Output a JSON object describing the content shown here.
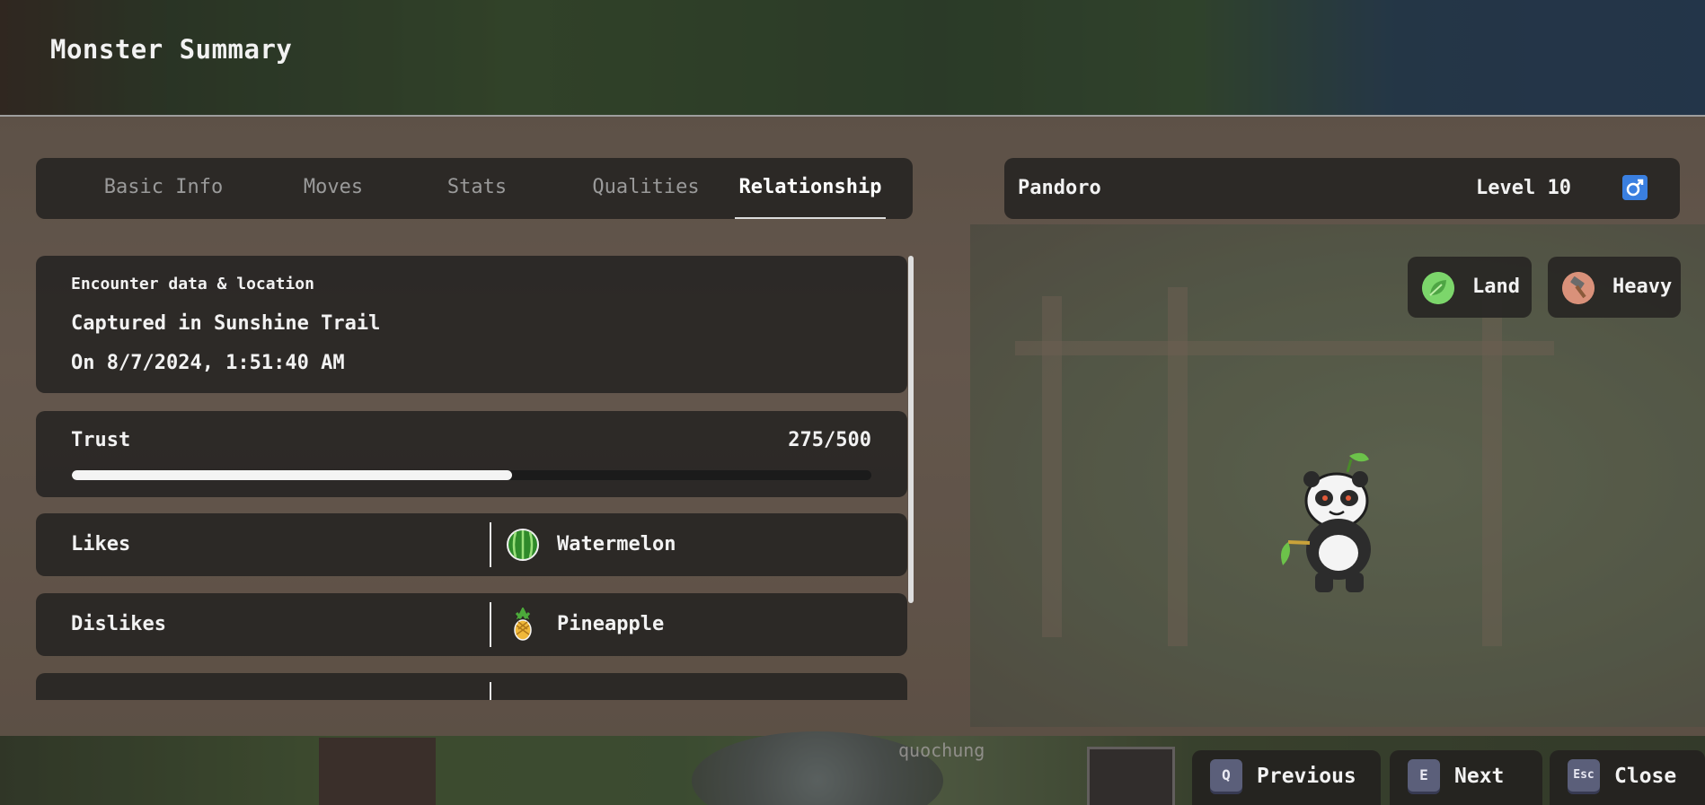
{
  "header": {
    "title": "Monster Summary"
  },
  "tabs": [
    {
      "label": "Basic Info",
      "active": false
    },
    {
      "label": "Moves",
      "active": false
    },
    {
      "label": "Stats",
      "active": false
    },
    {
      "label": "Qualities",
      "active": false
    },
    {
      "label": "Relationship",
      "active": true
    }
  ],
  "encounter": {
    "heading": "Encounter data & location",
    "line1": "Captured in Sunshine Trail",
    "line2": "On 8/7/2024, 1:51:40 AM"
  },
  "trust": {
    "label": "Trust",
    "value_text": "275/500",
    "current": 275,
    "max": 500
  },
  "preferences": {
    "likes": {
      "label": "Likes",
      "item": "Watermelon",
      "icon": "watermelon-icon"
    },
    "dislikes": {
      "label": "Dislikes",
      "item": "Pineapple",
      "icon": "pineapple-icon"
    }
  },
  "monster": {
    "name": "Pandoro",
    "level": "Level 10",
    "gender": "male",
    "gender_icon": "male-symbol-icon",
    "types": [
      {
        "label": "Land",
        "icon": "leaf-icon",
        "color": "#7cd66b"
      },
      {
        "label": "Heavy",
        "icon": "hammer-icon",
        "color": "#d9917a"
      }
    ]
  },
  "world": {
    "username": "quochung"
  },
  "controls": [
    {
      "key": "Q",
      "label": "Previous"
    },
    {
      "key": "E",
      "label": "Next"
    },
    {
      "key": "Esc",
      "label": "Close"
    }
  ],
  "colors": {
    "accent_gender": "#3a7fe0",
    "panel": "#282624",
    "key": "#5b5f7a"
  }
}
